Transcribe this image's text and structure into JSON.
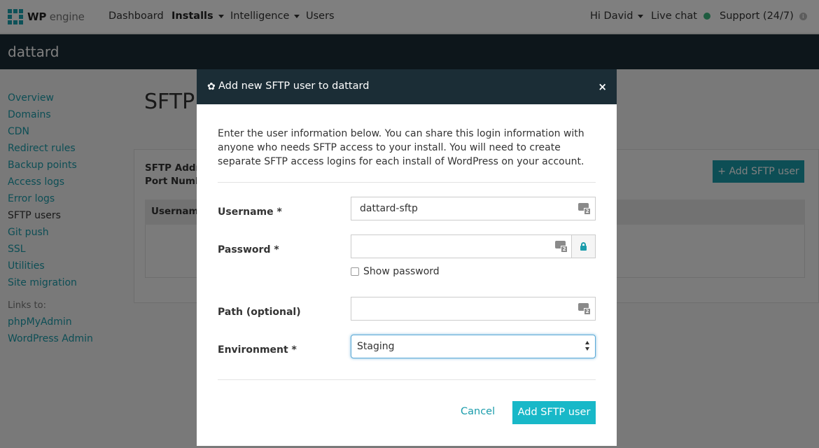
{
  "nav": {
    "logo_bold": "WP",
    "logo_rest": "engine",
    "items": [
      "Dashboard",
      "Installs",
      "Intelligence",
      "Users"
    ],
    "user_menu": "Hi David",
    "live_chat": "Live chat",
    "support": "Support (24/7)",
    "online_color": "#3bb77e"
  },
  "site": {
    "name": "dattard"
  },
  "sidebar": {
    "items": [
      "Overview",
      "Domains",
      "CDN",
      "Redirect rules",
      "Backup points",
      "Access logs",
      "Error logs",
      "SFTP users",
      "Git push",
      "SSL",
      "Utilities",
      "Site migration"
    ],
    "current": "SFTP users",
    "links_label": "Links to:",
    "links": [
      "phpMyAdmin",
      "WordPress Admin"
    ]
  },
  "page": {
    "title": "SFTP",
    "sftp_address_label": "SFTP Addre",
    "port_number_label": "Port Numb",
    "add_button": "+ Add SFTP user",
    "table_header": "Usernam"
  },
  "modal": {
    "title": "Add new SFTP user to dattard",
    "close": "×",
    "intro": "Enter the user information below. You can share this login information with anyone who needs SFTP access to your install. You will need to create separate SFTP access logins for each install of WordPress on your account.",
    "fields": {
      "username": {
        "label": "Username *",
        "value": "dattard-sftp"
      },
      "password": {
        "label": "Password *",
        "value": ""
      },
      "show_password": "Show password",
      "path": {
        "label": "Path (optional)",
        "value": ""
      },
      "environment": {
        "label": "Environment *",
        "value": "Staging"
      }
    },
    "cancel": "Cancel",
    "submit": "Add SFTP user",
    "accent": "#18b8c8"
  }
}
